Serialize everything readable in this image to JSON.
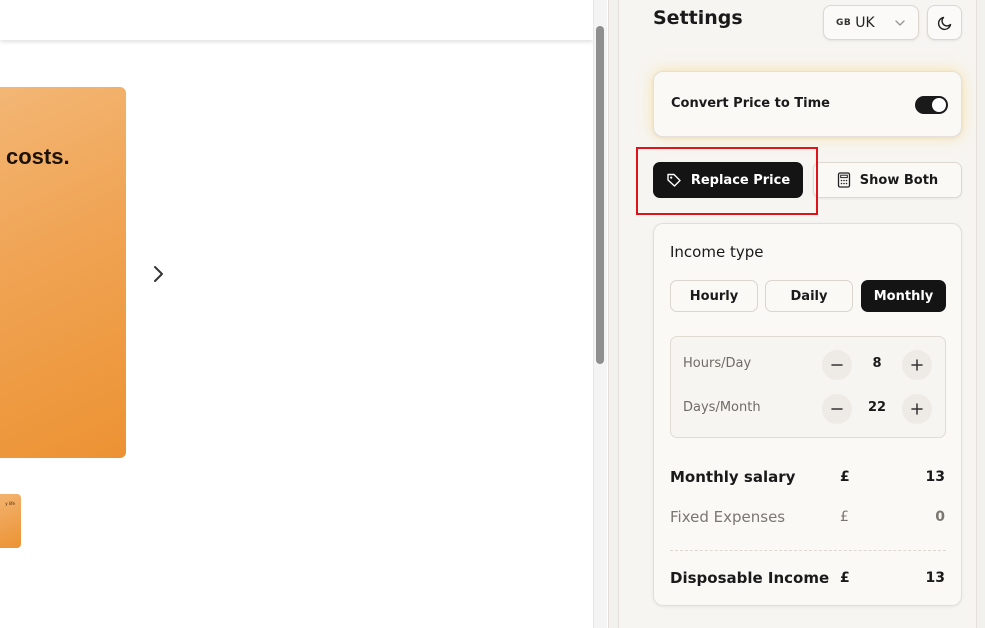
{
  "page": {
    "hero_text": "costs.",
    "thumb_text": "y life"
  },
  "settings": {
    "title": "Settings",
    "region": {
      "flag": "GB",
      "label": "UK"
    },
    "convert_label": "Convert Price to Time",
    "convert_enabled": true,
    "modes": {
      "replace": "Replace Price",
      "both": "Show Both",
      "selected": "replace"
    },
    "income_type": {
      "title": "Income type",
      "options": [
        "Hourly",
        "Daily",
        "Monthly"
      ],
      "selected": "Monthly"
    },
    "hours_day": {
      "label": "Hours/Day",
      "value": "8"
    },
    "days_month": {
      "label": "Days/Month",
      "value": "22"
    },
    "monthly_salary": {
      "label": "Monthly salary",
      "currency": "£",
      "value": "13"
    },
    "fixed_expenses": {
      "label": "Fixed Expenses",
      "currency": "£",
      "value": "0"
    },
    "disposable_income": {
      "label": "Disposable Income",
      "currency": "£",
      "value": "13"
    }
  },
  "colors": {
    "accent": "#141414",
    "highlight": "#e0121b",
    "hero": "#ec9233"
  }
}
